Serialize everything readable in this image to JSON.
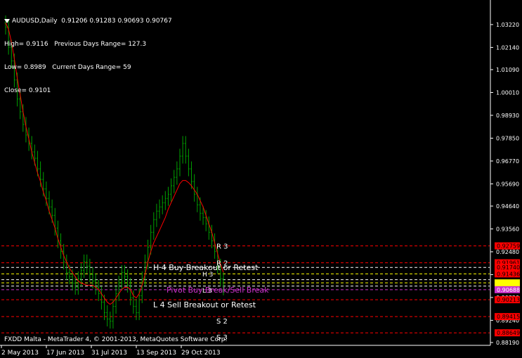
{
  "header": {
    "symbol": "AUDUSD,Daily",
    "ohlc": "0.91206 0.91283 0.90693 0.90767"
  },
  "info": {
    "high": "High= 0.9116",
    "prev_range": "Previous Days Range= 127.3",
    "low": "Low= 0.8989",
    "cur_range": "Current Days Range= 59",
    "close": "Close= 0.9101"
  },
  "footer": "FXDD Malta - MetaTrader 4, © 2001-2013, MetaQuotes Software Corp.",
  "colors": {
    "background": "#000000",
    "candle": "#00a000",
    "ma": "#ff0000",
    "red_level": "#ff0000",
    "yellow_level": "#ffff00",
    "white_level": "#ffffff",
    "pivot_label": "#cc33cc",
    "highlight_box": "#ffff00",
    "pivot_box": "#cc33cc"
  },
  "chart_data": {
    "type": "candlestick",
    "x_dates": [
      "2 May 2013",
      "17 Jun 2013",
      "31 Jul 2013",
      "13 Sep 2013",
      "29 Oct 2013"
    ],
    "y_ticks": [
      "1.03220",
      "1.02140",
      "1.01090",
      "1.00010",
      "0.98930",
      "0.97850",
      "0.96770",
      "0.95690",
      "0.94640",
      "0.93560",
      "0.92480",
      "0.91400",
      "0.90320",
      "0.89240",
      "0.88190"
    ],
    "ylim": [
      0.8819,
      1.0355
    ],
    "closes": [
      1.031,
      1.0215,
      1.015,
      1.006,
      0.997,
      0.991,
      0.985,
      0.98,
      0.976,
      0.972,
      0.969,
      0.964,
      0.959,
      0.9545,
      0.95,
      0.946,
      0.942,
      0.936,
      0.93,
      0.925,
      0.92,
      0.915,
      0.913,
      0.91,
      0.908,
      0.912,
      0.916,
      0.92,
      0.918,
      0.914,
      0.911,
      0.908,
      0.905,
      0.901,
      0.896,
      0.893,
      0.892,
      0.899,
      0.905,
      0.91,
      0.915,
      0.913,
      0.909,
      0.903,
      0.899,
      0.896,
      0.904,
      0.912,
      0.92,
      0.927,
      0.934,
      0.94,
      0.944,
      0.946,
      0.948,
      0.95,
      0.952,
      0.956,
      0.96,
      0.964,
      0.97,
      0.976,
      0.97,
      0.964,
      0.958,
      0.952,
      0.947,
      0.943,
      0.941,
      0.938,
      0.934,
      0.93,
      0.925,
      0.918,
      0.912,
      0.9077
    ],
    "ma_levels": [
      1.033,
      1.03,
      1.024,
      1.016,
      1.007,
      0.999,
      0.991,
      0.984,
      0.978,
      0.972,
      0.967,
      0.962,
      0.958,
      0.953,
      0.949,
      0.944,
      0.94,
      0.936,
      0.931,
      0.927,
      0.923,
      0.92,
      0.917,
      0.915,
      0.913,
      0.911,
      0.91,
      0.9095,
      0.909,
      0.909,
      0.909,
      0.908,
      0.907,
      0.905,
      0.903,
      0.901,
      0.9,
      0.901,
      0.903,
      0.905,
      0.907,
      0.908,
      0.908,
      0.907,
      0.904,
      0.903,
      0.905,
      0.909,
      0.914,
      0.92,
      0.925,
      0.929,
      0.932,
      0.935,
      0.938,
      0.941,
      0.945,
      0.948,
      0.951,
      0.954,
      0.957,
      0.9585,
      0.9585,
      0.9575,
      0.956,
      0.954,
      0.952,
      0.949,
      0.946,
      0.942,
      0.938,
      0.934,
      0.929,
      0.924,
      0.919,
      0.915
    ],
    "levels": [
      {
        "value": 0.92759,
        "label": "R 3",
        "tag": "0.92759",
        "color": "red",
        "tag_color": "red"
      },
      {
        "value": 0.91961,
        "label": "R 2",
        "tag": "0.91961",
        "color": "red",
        "tag_color": "red"
      },
      {
        "value": 0.9174,
        "label": "H 4 Buy Breakout or Retest",
        "tag": "0.91740",
        "color": "white",
        "tag_color": "red"
      },
      {
        "value": 0.91436,
        "label": "",
        "tag": "0.91436",
        "color": "yellow",
        "tag_color": "red"
      },
      {
        "value": 0.9116,
        "label": "",
        "tag": "",
        "color": "white",
        "tag_color": "none"
      },
      {
        "value": 0.9101,
        "label": "",
        "tag": "",
        "color": "yellow",
        "tag_color": "yellow"
      },
      {
        "value": 0.9086,
        "label": "",
        "tag": "",
        "color": "white",
        "tag_color": "yellow"
      },
      {
        "value": 0.90688,
        "label": "Pivot Buy Break/Sell Break",
        "tag": "0.90688",
        "color": "pivot",
        "tag_color": "pivot"
      },
      {
        "value": 0.90213,
        "label": "L 4 Sell Breakout or Retest",
        "tag": "0.90213",
        "color": "red",
        "tag_color": "red"
      },
      {
        "value": 0.89415,
        "label": "S 2",
        "tag": "0.89415",
        "color": "red",
        "tag_color": "red"
      },
      {
        "value": 0.88649,
        "label": "S 3",
        "tag": "0.88649",
        "color": "red",
        "tag_color": "red"
      }
    ],
    "pivot_labels": [
      "H 3",
      "L 3"
    ]
  }
}
